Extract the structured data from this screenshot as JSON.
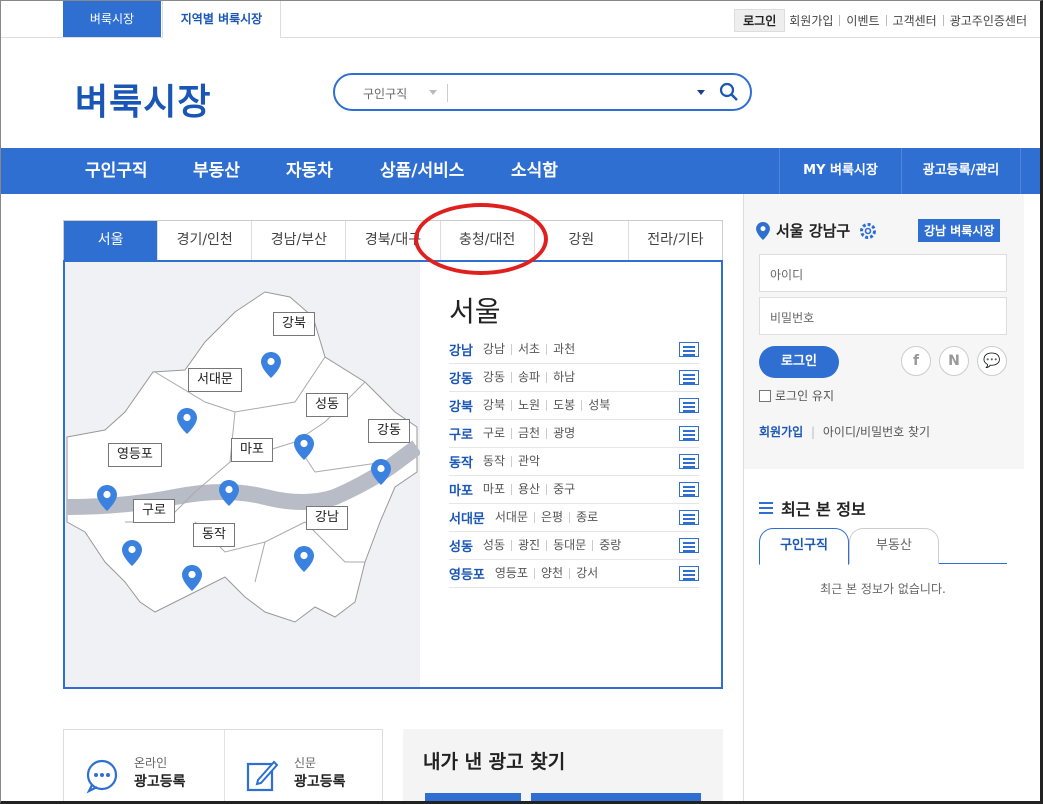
{
  "topbar": {
    "tab_market": "벼룩시장",
    "tab_regional": "지역별 벼룩시장",
    "login": "로그인",
    "links": [
      "회원가입",
      "이벤트",
      "고객센터",
      "광고주인증센터"
    ]
  },
  "header": {
    "logo": "벼룩시장",
    "search_category": "구인구직",
    "search_placeholder": ""
  },
  "nav": {
    "items": [
      "구인구직",
      "부동산",
      "자동차",
      "상품/서비스",
      "소식함"
    ],
    "right": [
      "MY 벼룩시장",
      "광고등록/관리"
    ]
  },
  "region_tabs": [
    "서울",
    "경기/인천",
    "경남/부산",
    "경북/대구",
    "충청/대전",
    "강원",
    "전라/기타"
  ],
  "map": {
    "labels": [
      "강북",
      "서대문",
      "성동",
      "강동",
      "영등포",
      "마포",
      "구로",
      "동작",
      "강남"
    ]
  },
  "district_panel": {
    "city": "서울",
    "rows": [
      {
        "name": "강남",
        "subs": [
          "강남",
          "서초",
          "과천"
        ]
      },
      {
        "name": "강동",
        "subs": [
          "강동",
          "송파",
          "하남"
        ]
      },
      {
        "name": "강북",
        "subs": [
          "강북",
          "노원",
          "도봉",
          "성북"
        ]
      },
      {
        "name": "구로",
        "subs": [
          "구로",
          "금천",
          "광명"
        ]
      },
      {
        "name": "동작",
        "subs": [
          "동작",
          "관악"
        ]
      },
      {
        "name": "마포",
        "subs": [
          "마포",
          "용산",
          "중구"
        ]
      },
      {
        "name": "서대문",
        "subs": [
          "서대문",
          "은평",
          "종로"
        ]
      },
      {
        "name": "성동",
        "subs": [
          "성동",
          "광진",
          "동대문",
          "중랑"
        ]
      },
      {
        "name": "영등포",
        "subs": [
          "영등포",
          "양천",
          "강서"
        ]
      }
    ]
  },
  "sidebar": {
    "location": "서울 강남구",
    "badge": "강남 벼룩시장",
    "id_placeholder": "아이디",
    "pw_placeholder": "비밀번호",
    "login_button": "로그인",
    "social": [
      "f",
      "N",
      "💬"
    ],
    "keep_login": "로그인 유지",
    "join": "회원가입",
    "find": "아이디/비밀번호 찾기",
    "recent_title": "최근 본 정보",
    "recent_tabs": [
      "구인구직",
      "부동산"
    ],
    "recent_empty": "최근 본 정보가 없습니다."
  },
  "bottom": {
    "online_line1": "온라인",
    "online_line2": "광고등록",
    "paper_line1": "신문",
    "paper_line2": "광고등록",
    "find_title": "내가 낸 광고 찾기"
  },
  "colors": {
    "brand": "#2f6fd1",
    "highlight": "#e0201f"
  }
}
